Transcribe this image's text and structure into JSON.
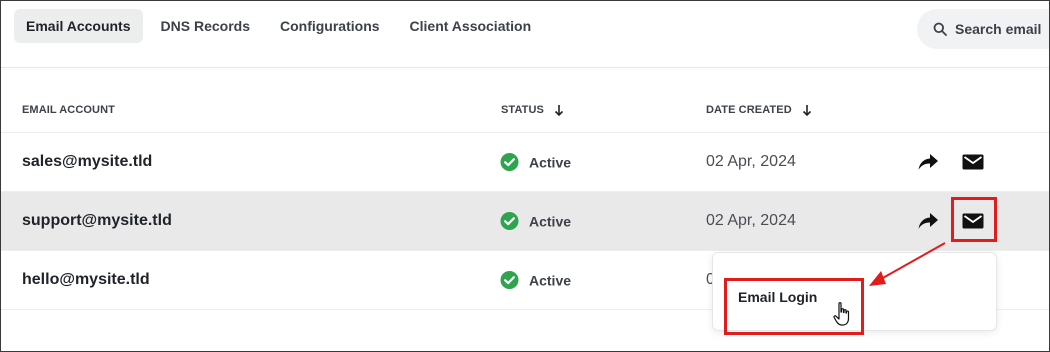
{
  "tabs": [
    {
      "label": "Email Accounts",
      "active": true
    },
    {
      "label": "DNS Records",
      "active": false
    },
    {
      "label": "Configurations",
      "active": false
    },
    {
      "label": "Client Association",
      "active": false
    }
  ],
  "search": {
    "placeholder": "Search email",
    "icon": "search-icon"
  },
  "table": {
    "columns": {
      "email": "EMAIL ACCOUNT",
      "status": "STATUS",
      "date": "DATE CREATED"
    },
    "rows": [
      {
        "email": "sales@mysite.tld",
        "status": "Active",
        "date": "02 Apr, 2024"
      },
      {
        "email": "support@mysite.tld",
        "status": "Active",
        "date": "02 Apr, 2024"
      },
      {
        "email": "hello@mysite.tld",
        "status": "Active",
        "date": "0"
      }
    ]
  },
  "dropdown": {
    "item": "Email Login"
  },
  "colors": {
    "accent_red": "#e21b1b",
    "status_green": "#2ea44f",
    "active_tab_bg": "#eceded",
    "row_highlight": "#e9e9e9"
  }
}
